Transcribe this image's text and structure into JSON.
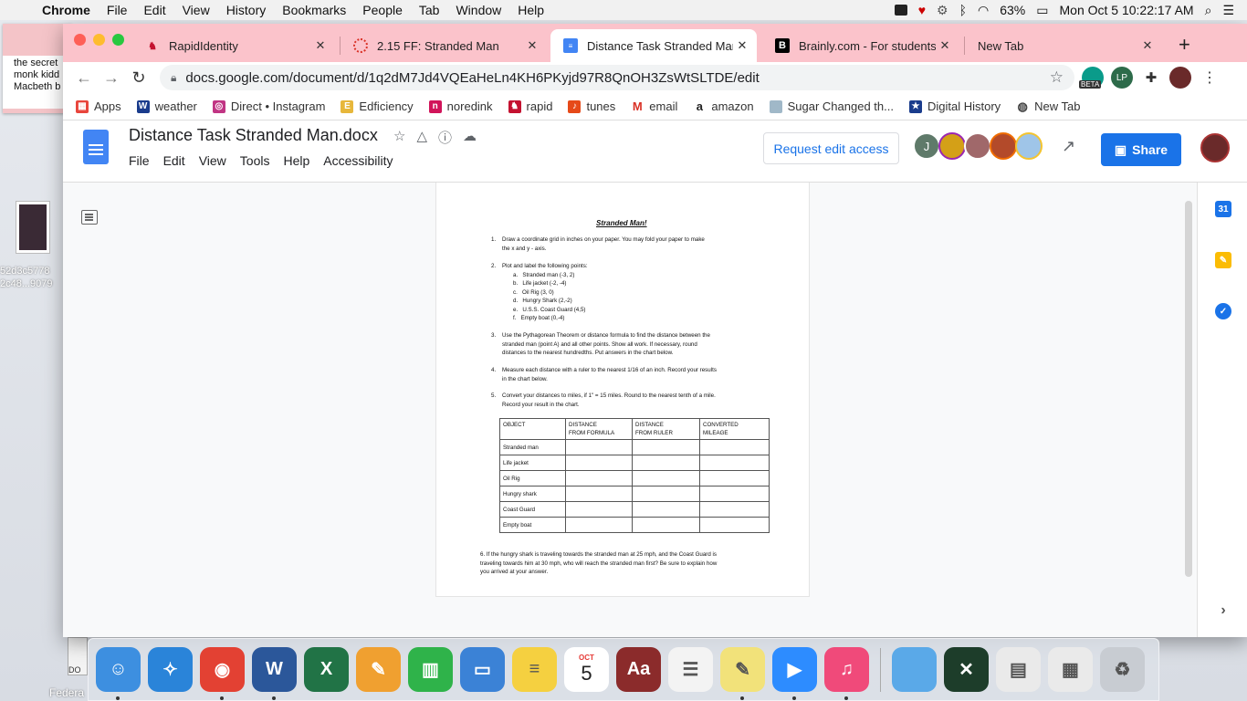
{
  "menubar": {
    "app_name": "Chrome",
    "items": [
      "File",
      "Edit",
      "View",
      "History",
      "Bookmarks",
      "People",
      "Tab",
      "Window",
      "Help"
    ],
    "battery": "63%",
    "datetime": "Mon Oct 5  10:22:17 AM"
  },
  "desktop": {
    "sticky_lines": [
      "the secret",
      "monk kidd",
      "Macbeth b"
    ],
    "file_label_1": "52d3c5778",
    "file_label_2": "2c48...9079",
    "doc_label": "DO",
    "bottom_label": "Federa"
  },
  "browser": {
    "tabs": [
      {
        "title": "RapidIdentity",
        "active": false,
        "favicon_color": "#c41230"
      },
      {
        "title": "2.15 FF: Stranded Man",
        "active": false,
        "favicon_color": "#d93025"
      },
      {
        "title": "Distance Task Stranded Man",
        "active": true,
        "favicon_color": "#4285f4"
      },
      {
        "title": "Brainly.com - For students. B",
        "active": false,
        "favicon_color": "#000000"
      },
      {
        "title": "New Tab",
        "active": false,
        "favicon_color": ""
      }
    ],
    "url": "docs.google.com/document/d/1q2dM7Jd4VQEaHeLn4KH6PKyjd97R8QnOH3ZsWtSLTDE/edit",
    "ext_badge": "BETA",
    "bookmarks": [
      {
        "label": "Apps",
        "icon": "apps-grid-icon",
        "color": "#e8453c"
      },
      {
        "label": "weather",
        "icon": "weather-channel-icon",
        "color": "#1a3c8c"
      },
      {
        "label": "Direct • Instagram",
        "icon": "instagram-icon",
        "color": "#c13584"
      },
      {
        "label": "Edficiency",
        "icon": "edficiency-icon",
        "color": "#e7b73b"
      },
      {
        "label": "noredink",
        "icon": "noredink-icon",
        "color": "#d1145a"
      },
      {
        "label": "rapid",
        "icon": "rapid-icon",
        "color": "#c41230"
      },
      {
        "label": "tunes",
        "icon": "tunes-icon",
        "color": "#e64a19"
      },
      {
        "label": "email",
        "icon": "gmail-icon",
        "color": "#d93025"
      },
      {
        "label": "amazon",
        "icon": "amazon-icon",
        "color": "#222222"
      },
      {
        "label": "Sugar Changed th...",
        "icon": "sugar-icon",
        "color": "#a0b8c8"
      },
      {
        "label": "Digital History",
        "icon": "star-icon",
        "color": "#1a3c8c"
      },
      {
        "label": "New Tab",
        "icon": "globe-icon",
        "color": "#444444"
      }
    ]
  },
  "docs": {
    "title": "Distance Task Stranded Man.docx",
    "menu": [
      "File",
      "Edit",
      "View",
      "Tools",
      "Help",
      "Accessibility"
    ],
    "request_edit": "Request edit access",
    "share": "Share",
    "avatar_letter": "J",
    "accent": "#1a73e8"
  },
  "document": {
    "title": "Stranded Man!",
    "q1": {
      "num": "1.",
      "lines": [
        "Draw a coordinate grid in inches on your paper.  You may fold your paper to make",
        "the  x and y - axis."
      ]
    },
    "q2": {
      "num": "2.",
      "intro": "Plot and label the following points:",
      "points": [
        {
          "letter": "a.",
          "text": "Stranded man   (-3, 2)"
        },
        {
          "letter": "b.",
          "text": "Life jacket   (-2, -4)"
        },
        {
          "letter": "c.",
          "text": "Oil Rig   (3, 0)"
        },
        {
          "letter": "d.",
          "text": "Hungry Shark   (2,-2)"
        },
        {
          "letter": "e.",
          "text": "U.S.S. Coast Guard   (4,5)"
        },
        {
          "letter": "f.",
          "text": "Empty boat   (0,-4)"
        }
      ]
    },
    "q3": {
      "num": "3.",
      "lines": [
        "Use the Pythagorean Theorem or distance formula to find the distance between the",
        "stranded man  (point A)  and all other points.  Show all work.  If necessary, round",
        "distances to the nearest hundredths.  Put answers in the chart below."
      ]
    },
    "q4": {
      "num": "4.",
      "lines": [
        "Measure each distance with a ruler to the nearest 1/16 of an inch.  Record your results",
        "in the chart below."
      ]
    },
    "q5": {
      "num": "5.",
      "lines": [
        "Convert your distances to miles, if  1\" = 15 miles.  Round to the nearest tenth of a mile.",
        "Record your result in the chart."
      ]
    },
    "table": {
      "headers": [
        [
          "OBJECT"
        ],
        [
          "DISTANCE",
          "FROM FORMULA"
        ],
        [
          "DISTANCE",
          "FROM RULER"
        ],
        [
          "CONVERTED",
          "MILEAGE"
        ]
      ],
      "rows": [
        "Stranded man",
        "Life jacket",
        "Oil Rig",
        "Hungry shark",
        "Coast Guard",
        "Empty boat"
      ]
    },
    "q6": {
      "lines": [
        "6. If the hungry shark is traveling towards the stranded man at 25 mph, and the Coast Guard is",
        "traveling towards him at 30 mph, who will reach the stranded man first?  Be sure to explain how",
        "you arrived at your answer."
      ]
    }
  },
  "calendar_day": "5",
  "calendar_month": "OCT",
  "dock": [
    {
      "name": "finder-icon",
      "color": "#3d8fe0",
      "glyph": "☺",
      "running": true
    },
    {
      "name": "safari-icon",
      "color": "#2a84d9",
      "glyph": "✧",
      "running": false
    },
    {
      "name": "chrome-icon",
      "color": "#e34133",
      "glyph": "◉",
      "running": true
    },
    {
      "name": "word-icon",
      "color": "#2b579a",
      "glyph": "W",
      "running": true
    },
    {
      "name": "excel-icon",
      "color": "#217346",
      "glyph": "X",
      "running": false
    },
    {
      "name": "pages-icon",
      "color": "#f0a030",
      "glyph": "✎",
      "running": false
    },
    {
      "name": "numbers-icon",
      "color": "#2fb34a",
      "glyph": "▥",
      "running": false
    },
    {
      "name": "keynote-icon",
      "color": "#3b82d6",
      "glyph": "▭",
      "running": false
    },
    {
      "name": "notes-icon",
      "color": "#f5d040",
      "glyph": "≡",
      "running": false
    },
    {
      "name": "calendar-icon",
      "color": "#ffffff",
      "glyph": "",
      "running": false
    },
    {
      "name": "dictionary-icon",
      "color": "#8b2b2b",
      "glyph": "Aa",
      "running": false
    },
    {
      "name": "reminders-icon",
      "color": "#f3f3f3",
      "glyph": "☰",
      "running": false
    },
    {
      "name": "stickies-icon",
      "color": "#f2e27a",
      "glyph": "✎",
      "running": true
    },
    {
      "name": "zoom-icon",
      "color": "#2d8cff",
      "glyph": "▶",
      "running": true
    },
    {
      "name": "itunes-icon",
      "color": "#f04a7a",
      "glyph": "♫",
      "running": true
    },
    {
      "name": "folder-icon",
      "color": "#5aa9e8",
      "glyph": "",
      "running": false
    },
    {
      "name": "geogebra-icon",
      "color": "#1d3d2a",
      "glyph": "✕",
      "running": false
    },
    {
      "name": "screenshot-doc-icon",
      "color": "#eaeaea",
      "glyph": "▤",
      "running": false
    },
    {
      "name": "screenshot-doc2-icon",
      "color": "#eaeaea",
      "glyph": "▦",
      "running": false
    },
    {
      "name": "trash-icon",
      "color": "#c8ccd2",
      "glyph": "♻",
      "running": false
    }
  ]
}
